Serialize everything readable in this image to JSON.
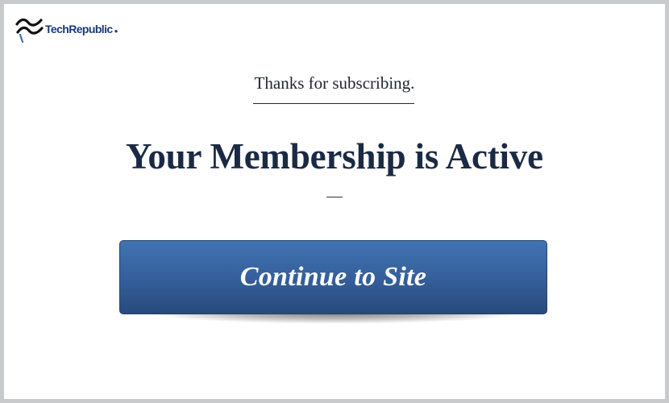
{
  "brand": {
    "name": "TechRepublic",
    "logo_icon": "techrepublic-wave-logo",
    "color": "#1a3a78"
  },
  "subtitle": "Thanks for subscribing.",
  "headline": "Your Membership is Active",
  "cta": {
    "label": "Continue to Site",
    "color_top": "#4273b2",
    "color_bottom": "#284a7c"
  },
  "colors": {
    "background_frame": "#c9cacc",
    "headline_text": "#1b2a44"
  }
}
